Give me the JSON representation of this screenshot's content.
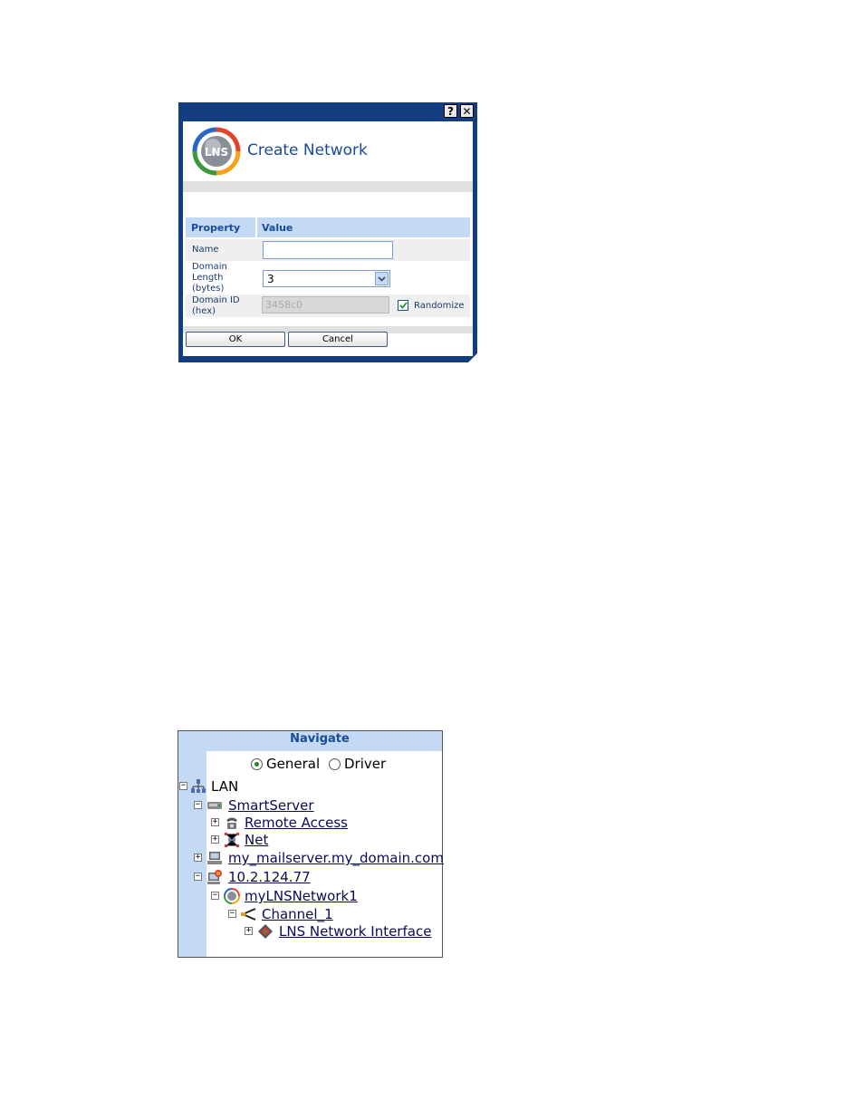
{
  "dialog": {
    "title": "Create Network",
    "logo_text": "LNS",
    "help_glyph": "?",
    "close_glyph": "✕",
    "table": {
      "headers": [
        "Property",
        "Value"
      ],
      "name_label": "Name",
      "name_value": "",
      "domain_length_label": [
        "Domain",
        "Length",
        "(bytes)"
      ],
      "domain_length_value": "3",
      "domain_id_label": [
        "Domain ID",
        "(hex)"
      ],
      "domain_id_value": "3458c0",
      "randomize_label": "Randomize",
      "randomize_checked": true
    },
    "buttons": {
      "ok": "OK",
      "cancel": "Cancel"
    }
  },
  "navigate": {
    "title": "Navigate",
    "radios": [
      {
        "label": "General",
        "selected": true
      },
      {
        "label": "Driver",
        "selected": false
      }
    ],
    "tree": [
      {
        "label": "LAN",
        "toggle": "−",
        "icon": "lan-icon",
        "link": false
      },
      {
        "label": "SmartServer",
        "toggle": "−",
        "icon": "smartserver-icon",
        "link": true
      },
      {
        "label": "Remote Access",
        "toggle": "+",
        "icon": "telephone-icon",
        "link": true
      },
      {
        "label": "Net",
        "toggle": "+",
        "icon": "network-icon",
        "link": true
      },
      {
        "label": "my_mailserver.my_domain.com",
        "toggle": "+",
        "icon": "computer-icon",
        "link": true
      },
      {
        "label": "10.2.124.77",
        "toggle": "−",
        "icon": "lns-server-icon",
        "link": true
      },
      {
        "label": "myLNSNetwork1",
        "toggle": "−",
        "icon": "lns-network-icon",
        "link": true
      },
      {
        "label": "Channel_1",
        "toggle": "−",
        "icon": "channel-icon",
        "link": true
      },
      {
        "label": "LNS Network Interface",
        "toggle": "+",
        "icon": "network-interface-icon",
        "link": true
      }
    ]
  }
}
